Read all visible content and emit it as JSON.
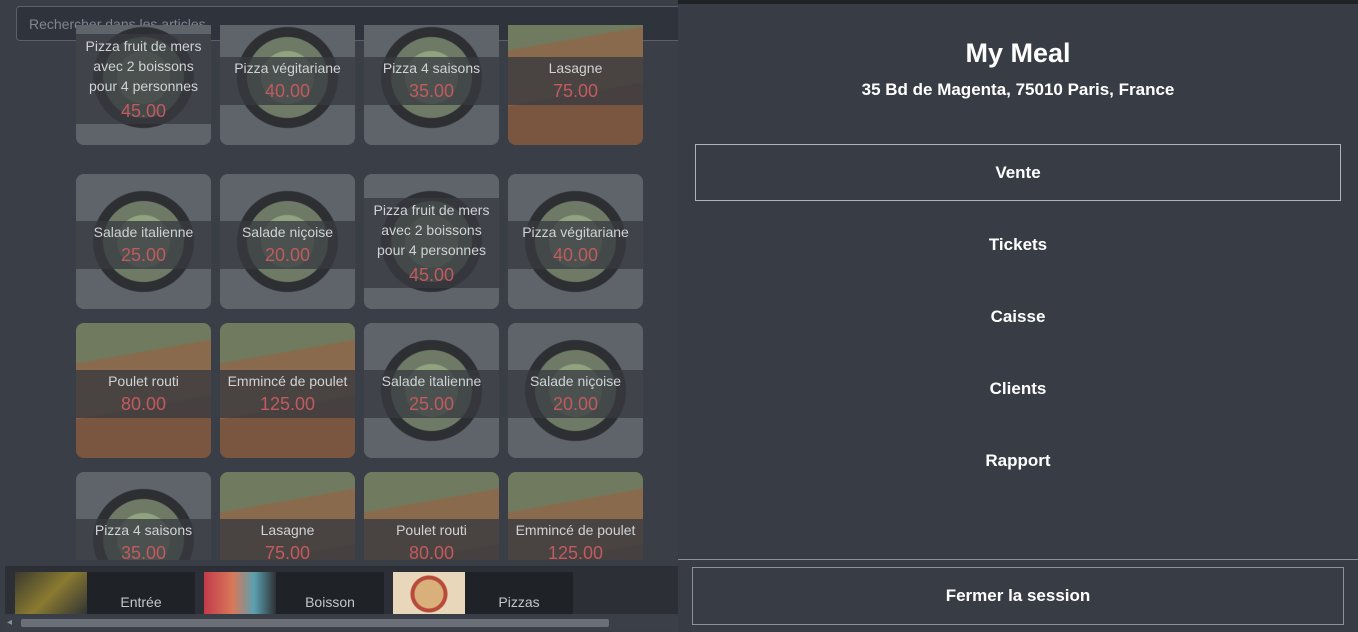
{
  "search": {
    "placeholder": "Rechercher dans les articles"
  },
  "products": [
    {
      "name": "Pizza fruit de mers avec 2 boissons pour 4 personnes",
      "price": "45.00",
      "pic": "pizza"
    },
    {
      "name": "Pizza végitariane",
      "price": "40.00",
      "pic": "pizza"
    },
    {
      "name": "Pizza 4 saisons",
      "price": "35.00",
      "pic": "pizza"
    },
    {
      "name": "Lasagne",
      "price": "75.00",
      "pic": "lasagne"
    },
    {
      "name": "Salade italienne",
      "price": "25.00",
      "pic": "pizza"
    },
    {
      "name": "Salade niçoise",
      "price": "20.00",
      "pic": "pizza"
    },
    {
      "name": "Pizza fruit de mers avec 2 boissons pour 4 personnes",
      "price": "45.00",
      "pic": "pizza"
    },
    {
      "name": "Pizza végitariane",
      "price": "40.00",
      "pic": "pizza"
    },
    {
      "name": "Poulet routi",
      "price": "80.00",
      "pic": "lasagne"
    },
    {
      "name": "Emmincé de poulet",
      "price": "125.00",
      "pic": "lasagne"
    },
    {
      "name": "Salade italienne",
      "price": "25.00",
      "pic": "pizza"
    },
    {
      "name": "Salade niçoise",
      "price": "20.00",
      "pic": "pizza"
    },
    {
      "name": "Pizza 4 saisons",
      "price": "35.00",
      "pic": "pizza"
    },
    {
      "name": "Lasagne",
      "price": "75.00",
      "pic": "lasagne"
    },
    {
      "name": "Poulet routi",
      "price": "80.00",
      "pic": "lasagne"
    },
    {
      "name": "Emmincé de poulet",
      "price": "125.00",
      "pic": "lasagne"
    }
  ],
  "categories": [
    {
      "label": "Entrée",
      "icon": "entree-thumb"
    },
    {
      "label": "Boisson",
      "icon": "drinks-thumb"
    },
    {
      "label": "Pizzas",
      "icon": "pizza-thumb"
    }
  ],
  "drawer": {
    "brand": "My Meal",
    "address": "35 Bd de Magenta, 75010 Paris, France",
    "menu": [
      "Vente",
      "Tickets",
      "Caisse",
      "Clients",
      "Rapport"
    ],
    "active_menu": "Vente",
    "logout": "Fermer la session"
  }
}
